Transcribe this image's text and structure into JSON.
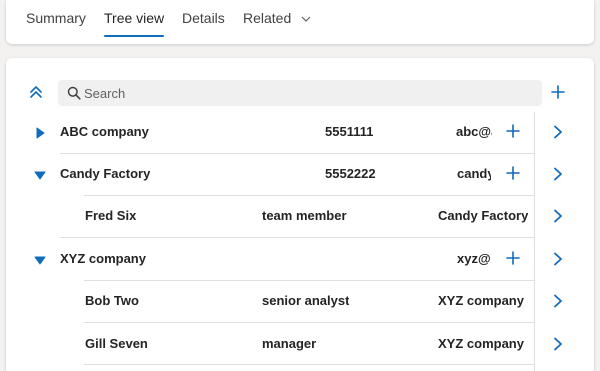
{
  "tabs": [
    {
      "label": "Summary"
    },
    {
      "label": "Tree view"
    },
    {
      "label": "Details"
    },
    {
      "label": "Related"
    }
  ],
  "search": {
    "placeholder": "Search",
    "value": ""
  },
  "rows": [
    {
      "name": "ABC company",
      "col2": "5551111",
      "col3": "abc@abc",
      "expanded": false
    },
    {
      "name": "Candy Factory",
      "col2": "5552222",
      "col3": "candy@candy",
      "expanded": true
    },
    {
      "name": "Fred Six",
      "col2": "team member",
      "col3": "Candy Factory"
    },
    {
      "name": "XYZ company",
      "col2": "",
      "col3": "xyz@xyz",
      "expanded": true
    },
    {
      "name": "Bob Two",
      "col2": "senior analyst",
      "col3": "XYZ company"
    },
    {
      "name": "Gill Seven",
      "col2": "manager",
      "col3": "XYZ company"
    }
  ],
  "colors": {
    "accent": "#0f6cbd",
    "divider": "#e0e0e0"
  }
}
